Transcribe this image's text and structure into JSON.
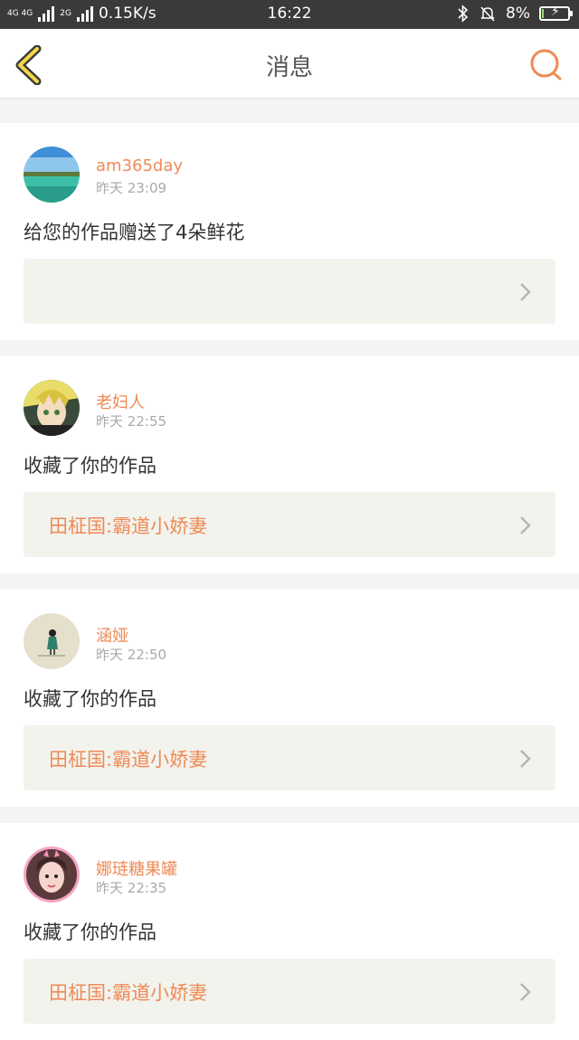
{
  "status_bar": {
    "network_tag_1": "4G 4G",
    "network_tag_2": "2G",
    "speed": "0.15K/s",
    "time": "16:22",
    "battery": "8%",
    "battery_level": 0.08
  },
  "nav": {
    "title": "消息",
    "back_icon": "chevron-left-icon",
    "search_icon": "search-icon",
    "accent_color": "#ef8a55"
  },
  "messages": [
    {
      "username": "am365day",
      "date": "昨天",
      "time": "23:09",
      "action": "给您的作品赠送了4朵鲜花",
      "ref_title": ""
    },
    {
      "username": "老妇人",
      "date": "昨天",
      "time": "22:55",
      "action": "收藏了你的作品",
      "ref_title": "田柾国:霸道小娇妻"
    },
    {
      "username": "涵娅",
      "date": "昨天",
      "time": "22:50",
      "action": "收藏了你的作品",
      "ref_title": "田柾国:霸道小娇妻"
    },
    {
      "username": "娜琏糖果罐",
      "date": "昨天",
      "time": "22:35",
      "action": "收藏了你的作品",
      "ref_title": "田柾国:霸道小娇妻"
    }
  ]
}
